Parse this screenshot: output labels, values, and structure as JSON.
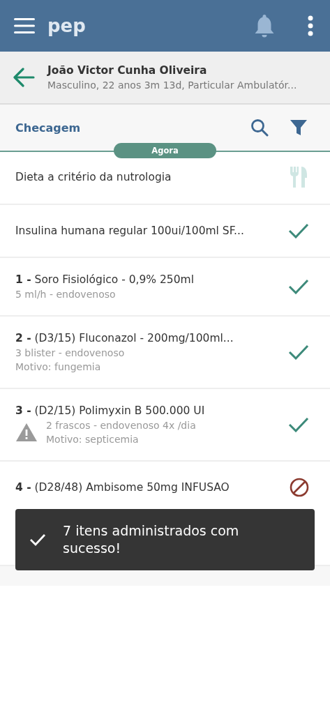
{
  "app_bar": {
    "title": "pep"
  },
  "patient": {
    "name": "João Victor Cunha Oliveira",
    "details": "Masculino, 22 anos 3m 13d, Particular Ambulatór..."
  },
  "section": {
    "title": "Checagem"
  },
  "time_marker": "Agora",
  "items": [
    {
      "kind": "diet",
      "title": "Dieta a critério da nutrologia",
      "warning": false
    },
    {
      "kind": "checked",
      "title": "Insulina humana regular 100ui/100ml SF...",
      "warning": false
    },
    {
      "kind": "checked",
      "title": "**1 -** Soro Fisiológico - 0,9% 250ml",
      "lines": [
        "5 ml/h - endovenoso"
      ],
      "warning": false
    },
    {
      "kind": "checked",
      "title": "**2 -** (D3/15) Fluconazol - 200mg/100ml...",
      "lines": [
        "3 blister - endovenoso",
        "Motivo: fungemia"
      ],
      "warning": false
    },
    {
      "kind": "checked",
      "title": "**3 -** (D2/15) Polimyxin B 500.000 UI",
      "lines": [
        "2 frascos - endovenoso 4x /dia",
        "Motivo: septicemia"
      ],
      "warning": true
    },
    {
      "kind": "blocked",
      "title": "**4 -** (D28/48) Ambisome 50mg INFUSAO",
      "warning": false
    }
  ],
  "toast": {
    "message": "7 itens administrados com sucesso!"
  }
}
